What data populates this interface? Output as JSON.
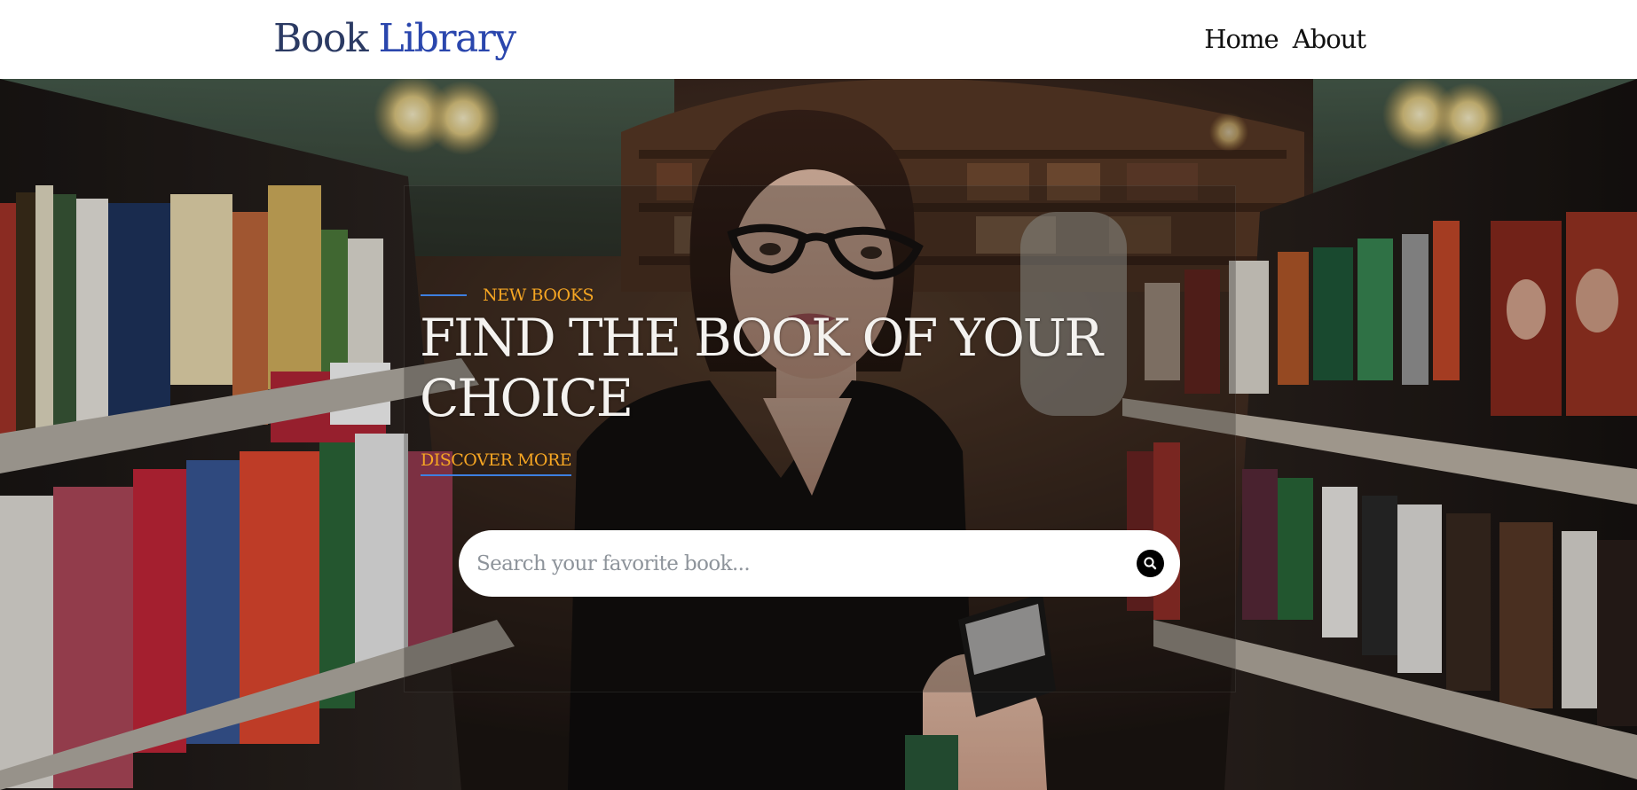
{
  "header": {
    "brand": {
      "part1": "Book",
      "part2": "Library"
    },
    "nav": [
      {
        "label": "Home"
      },
      {
        "label": "About"
      }
    ]
  },
  "hero": {
    "eyebrow": "NEW BOOKS",
    "title": "FIND THE BOOK OF YOUR CHOICE",
    "cta_label": "DISCOVER MORE",
    "search": {
      "value": "",
      "placeholder": "Search your favorite book...",
      "button_icon": "search-icon"
    }
  },
  "colors": {
    "brand_dark": "#2b3a63",
    "brand_blue": "#2a46ad",
    "accent_orange": "#f6a623",
    "accent_line": "#3d7fe0",
    "hero_text": "#f4f2ef"
  }
}
